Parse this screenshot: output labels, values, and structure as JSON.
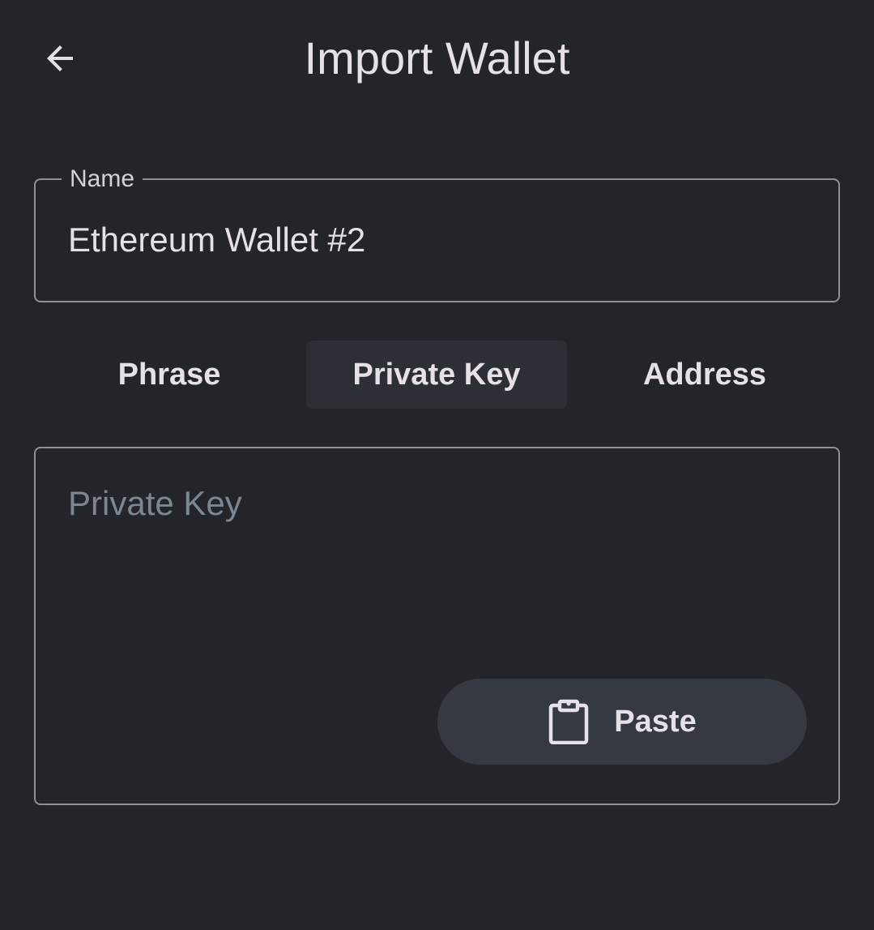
{
  "header": {
    "back_icon": "arrow-left-icon",
    "title": "Import Wallet"
  },
  "name_field": {
    "label": "Name",
    "value": "Ethereum Wallet #2"
  },
  "tabs": [
    {
      "label": "Phrase",
      "active": false
    },
    {
      "label": "Private Key",
      "active": true
    },
    {
      "label": "Address",
      "active": false
    }
  ],
  "key_field": {
    "placeholder": "Private Key",
    "value": ""
  },
  "paste_button": {
    "icon": "clipboard-icon",
    "label": "Paste"
  },
  "colors": {
    "background": "#23252a",
    "outline": "#938f99",
    "active_tab": "#2c2f35",
    "paste_button": "#353942",
    "placeholder": "#7b8791",
    "text": "#e6e1e8"
  }
}
